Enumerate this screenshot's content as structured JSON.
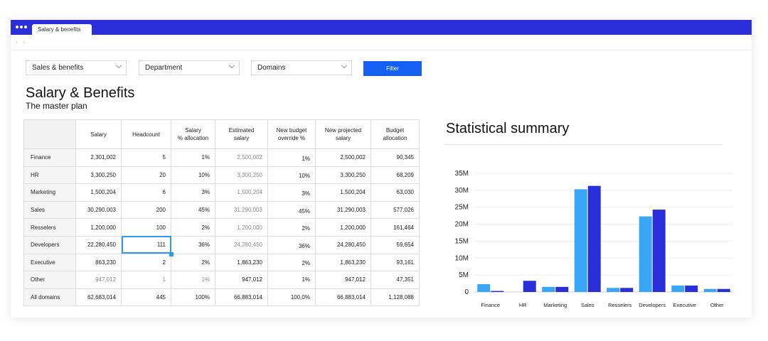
{
  "window": {
    "tab_title": "Salary & benefits"
  },
  "filters": {
    "select1": "Sales & benefits",
    "select2": "Department",
    "select3": "Domains",
    "button": "Filter"
  },
  "page": {
    "title": "Salary & Benefits",
    "subtitle": "The master plan"
  },
  "table": {
    "headers": [
      "",
      "Salary",
      "Headcount",
      "Salary\n% allocation",
      "Estimated\nsalary",
      "New budget\noverride %",
      "New projected\nsalary",
      "Budget\nallocation"
    ],
    "rows": [
      [
        "Finance",
        "2,301,002",
        "5",
        "1%",
        "2,500,002",
        "1%",
        "2,500,002",
        "90,345"
      ],
      [
        "HR",
        "3,300,250",
        "20",
        "10%",
        "3,300,250",
        "10%",
        "3,300,250",
        "68,209"
      ],
      [
        "Marketing",
        "1,500,204",
        "6",
        "3%",
        "1,500,204",
        "3%",
        "1,500,204",
        "63,030"
      ],
      [
        "Sales",
        "30,290,003",
        "200",
        "45%",
        "31,290,003",
        "45%",
        "31,290,003",
        "577,026"
      ],
      [
        "Resselers",
        "1,200,000",
        "100",
        "2%",
        "1,200,000",
        "2%",
        "1,200,000",
        "161,464"
      ],
      [
        "Developers",
        "22,280,450",
        "111",
        "36%",
        "24,280,450",
        "36%",
        "24,280,450",
        "59,654"
      ],
      [
        "Executive",
        "863,230",
        "2",
        "2%",
        "1,863,230",
        "2%",
        "1,863,230",
        "93,161"
      ],
      [
        "Other",
        "947,012",
        "1",
        "1%",
        "947,012",
        "1%",
        "947,012",
        "47,351"
      ],
      [
        "All domains",
        "62,683,014",
        "445",
        "100%",
        "66,883,014",
        "100,0%",
        "66,883,014",
        "1,128,088"
      ]
    ]
  },
  "stats": {
    "title": "Statistical summary"
  },
  "colors": {
    "accent": "#2b2fd9",
    "series_light": "#3aa6f6",
    "series_dark": "#2b2fd9",
    "filter_button": "#1560f2"
  },
  "chart_data": {
    "type": "bar",
    "categories": [
      "Finance",
      "HR",
      "Marketing",
      "Sales",
      "Resselers",
      "Developers",
      "Executive",
      "Other"
    ],
    "series": [
      {
        "values": [
          2.3,
          0,
          1.5,
          30.3,
          1.2,
          22.3,
          1.9,
          0.9
        ]
      },
      {
        "values": [
          0.3,
          3.3,
          1.5,
          31.3,
          1.2,
          24.3,
          1.9,
          0.9
        ]
      }
    ],
    "yticks": [
      "0",
      "5M",
      "10M",
      "15M",
      "20M",
      "25M",
      "30M",
      "35M"
    ],
    "ylim": [
      0,
      35
    ],
    "grid": true
  }
}
